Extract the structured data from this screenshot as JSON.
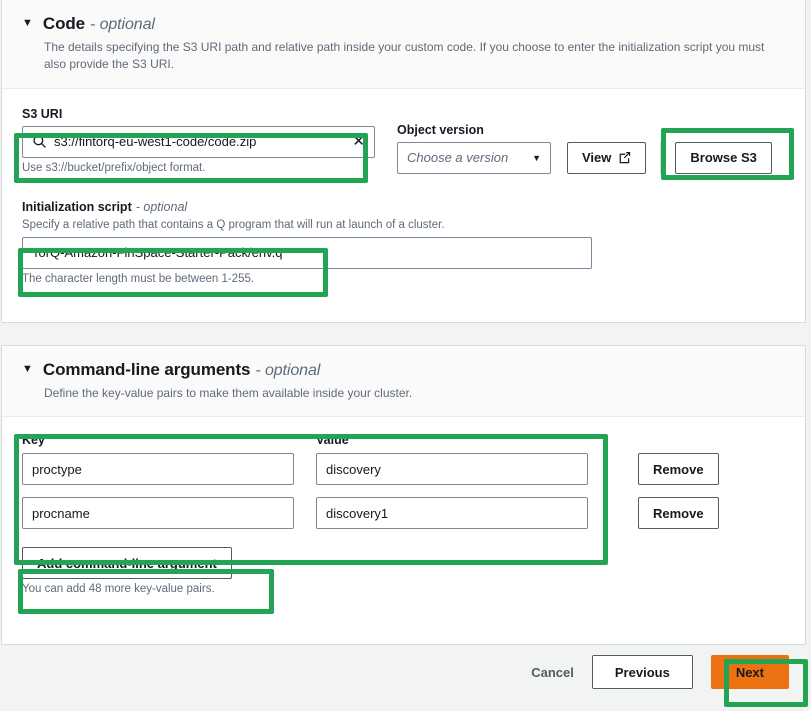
{
  "sections": [
    {
      "title": "Code",
      "optional_suffix": "- optional",
      "description": "The details specifying the S3 URI path and relative path inside your custom code. If you choose to enter the initialization script you must also provide the S3 URI.",
      "caret": "▼"
    },
    {
      "title": "Command-line arguments",
      "optional_suffix": "- optional",
      "description": "Define the key-value pairs to make them available inside your cluster.",
      "caret": "▼"
    }
  ],
  "code_section": {
    "s3_uri": {
      "label": "S3 URI",
      "value": "s3://fintorq-eu-west1-code/code.zip",
      "hint": "Use s3://bucket/prefix/object format.",
      "search_icon": "search-icon",
      "clear_icon": "✕"
    },
    "object_version": {
      "label": "Object version",
      "placeholder": "Choose a version",
      "caret": "▼"
    },
    "view_button": {
      "label": "View",
      "external_icon": "external-link-icon"
    },
    "browse_button": {
      "label": "Browse S3"
    },
    "init_script": {
      "label": "Initialization script",
      "optional_suffix": "- optional",
      "description": "Specify a relative path that contains a Q program that will run at launch of a cluster.",
      "value": "TorQ-Amazon-FinSpace-Starter-Pack/env.q",
      "hint": "The character length must be between 1-255."
    }
  },
  "cmdline_section": {
    "columns": {
      "key": "Key",
      "value": "Value"
    },
    "rows": [
      {
        "key": "proctype",
        "value": "discovery",
        "remove_label": "Remove"
      },
      {
        "key": "procname",
        "value": "discovery1",
        "remove_label": "Remove"
      }
    ],
    "add_button": {
      "label": "Add command-line argument"
    },
    "hint": "You can add 48 more key-value pairs."
  },
  "footer": {
    "cancel": "Cancel",
    "previous": "Previous",
    "next": "Next"
  },
  "colors": {
    "highlight": "#23a455",
    "primary_button": "#ec7211",
    "text": "#16191f",
    "muted_text": "#5f6b7a",
    "border": "#7d8998",
    "card_header_bg": "#fafafa",
    "page_bg": "#f2f3f3"
  }
}
